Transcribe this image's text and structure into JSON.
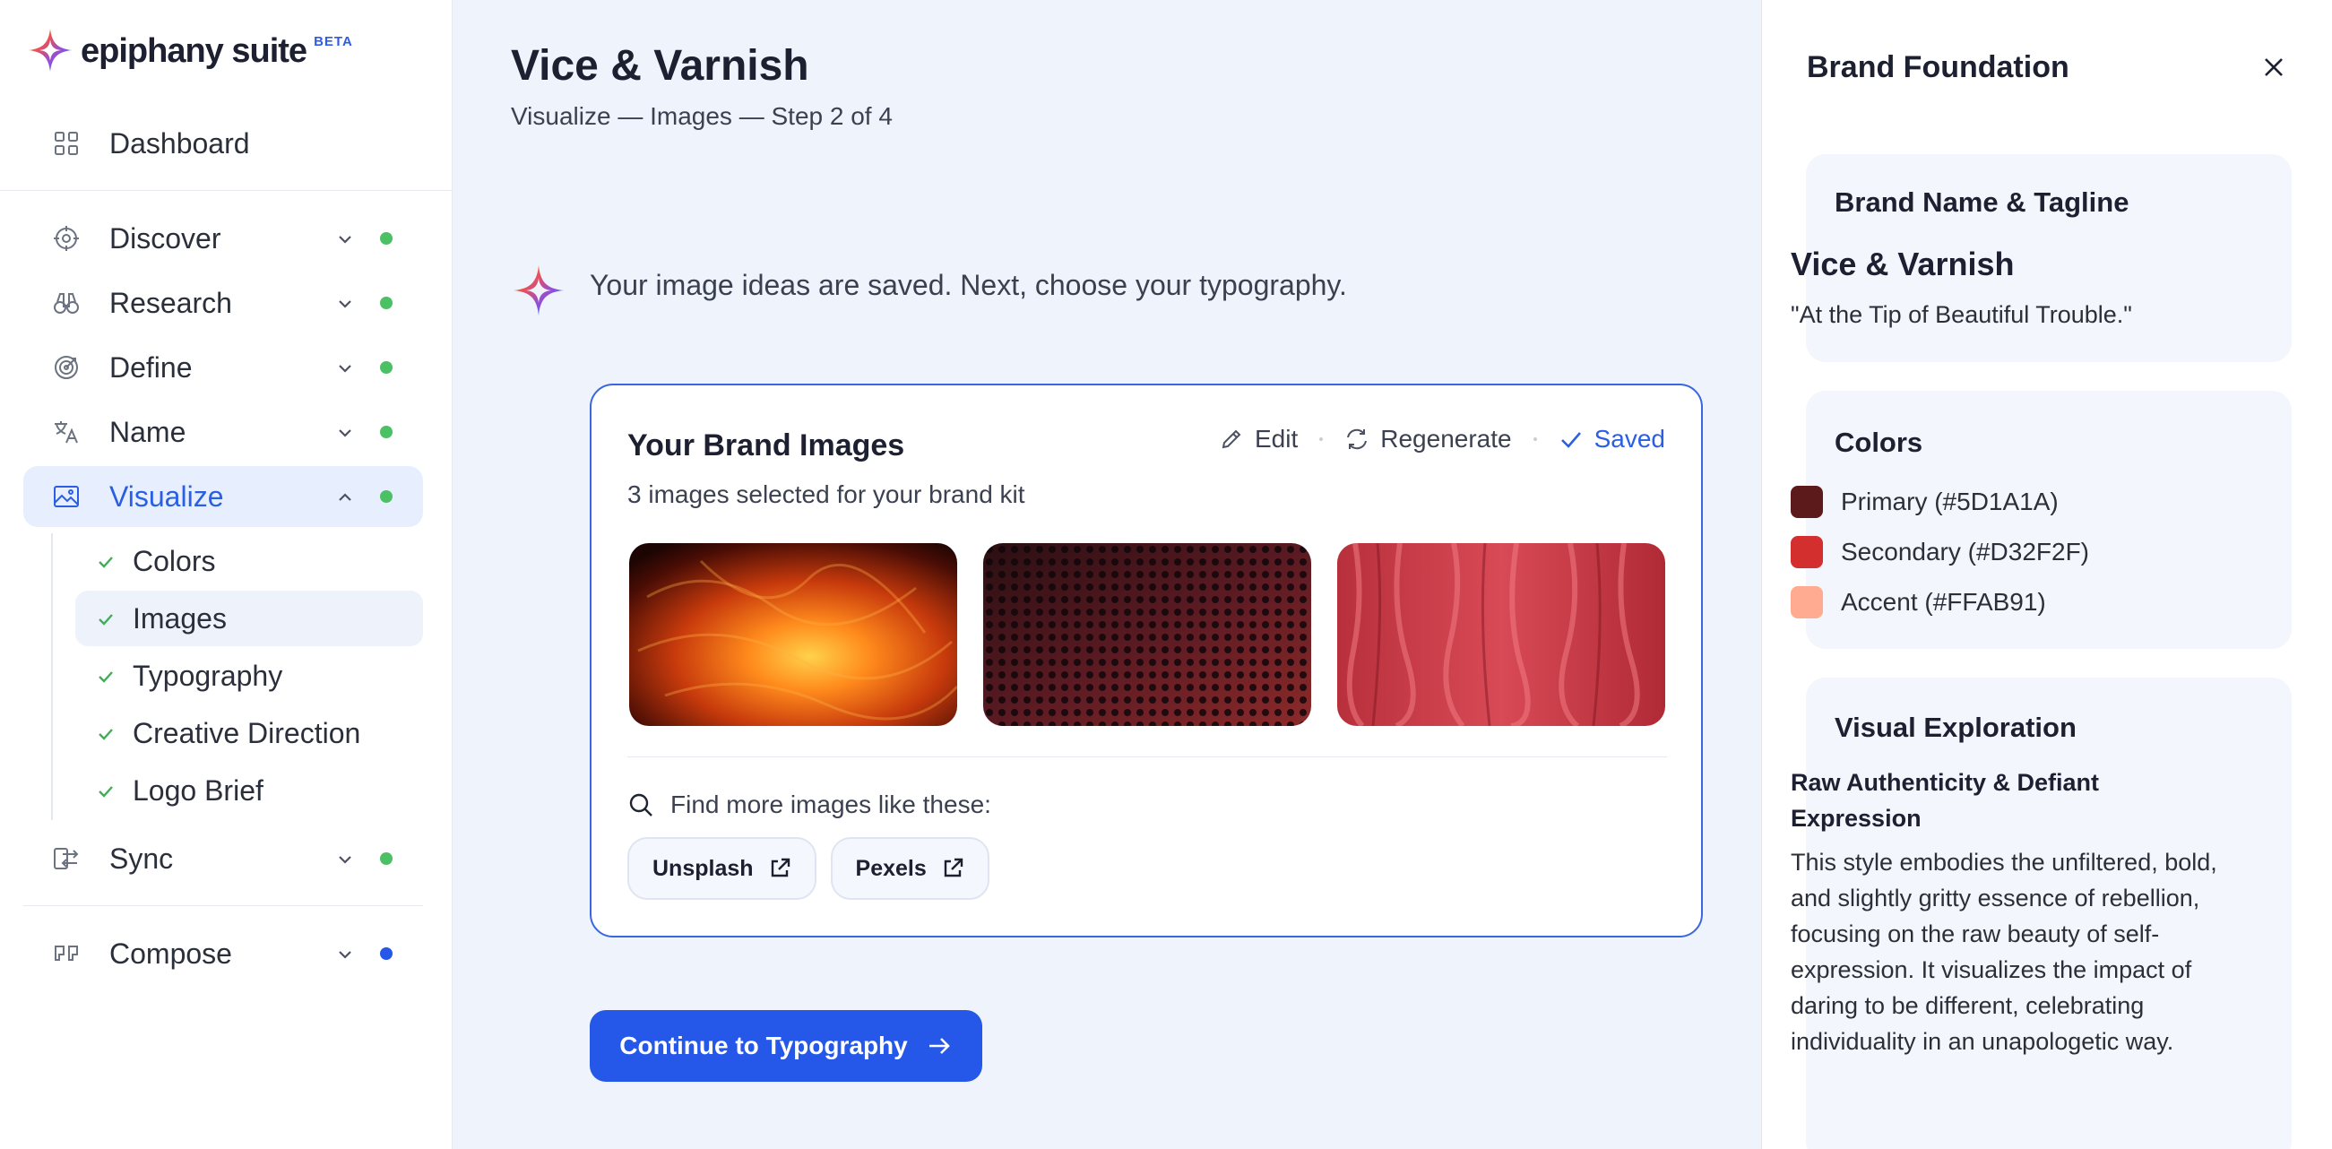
{
  "app": {
    "name": "epiphany suite",
    "badge": "BETA"
  },
  "sidebar": {
    "dashboard": "Dashboard",
    "items": [
      {
        "label": "Discover",
        "status": "complete"
      },
      {
        "label": "Research",
        "status": "complete"
      },
      {
        "label": "Define",
        "status": "complete"
      },
      {
        "label": "Name",
        "status": "complete"
      },
      {
        "label": "Visualize",
        "status": "complete",
        "expanded": true
      },
      {
        "label": "Sync",
        "status": "complete"
      },
      {
        "label": "Compose",
        "status": "in-progress"
      }
    ],
    "visualize_sub": [
      {
        "label": "Colors",
        "done": true
      },
      {
        "label": "Images",
        "done": true,
        "current": true
      },
      {
        "label": "Typography",
        "done": true
      },
      {
        "label": "Creative Direction",
        "done": true
      },
      {
        "label": "Logo Brief",
        "done": true
      }
    ]
  },
  "main": {
    "title": "Vice & Varnish",
    "subtitle": "Visualize — Images — Step 2 of 4",
    "assistant_message": "Your image ideas are saved. Next, choose your typography.",
    "card": {
      "title": "Your Brand Images",
      "subtitle": "3 images selected for your brand kit",
      "actions": {
        "edit": "Edit",
        "regenerate": "Regenerate",
        "saved": "Saved"
      },
      "images": [
        "warm-orange-abstract",
        "dark-red-perforated-metal",
        "red-textured-surface"
      ],
      "find_more": "Find more images like these:",
      "sources": [
        "Unsplash",
        "Pexels"
      ]
    },
    "continue_button": "Continue to Typography"
  },
  "panel": {
    "title": "Brand Foundation",
    "brand": {
      "heading": "Brand Name & Tagline",
      "name": "Vice & Varnish",
      "tagline": "\"At the Tip of Beautiful Trouble.\""
    },
    "colors": {
      "heading": "Colors",
      "items": [
        {
          "label": "Primary (#5D1A1A)",
          "hex": "#5D1A1A"
        },
        {
          "label": "Secondary (#D32F2F)",
          "hex": "#D32F2F"
        },
        {
          "label": "Accent (#FFAB91)",
          "hex": "#FFAB91"
        }
      ]
    },
    "visual": {
      "heading": "Visual Exploration",
      "style_title": "Raw Authenticity & Defiant Expression",
      "description": "This style embodies the unfiltered, bold, and slightly gritty essence of rebellion, focusing on the raw beauty of self-expression. It visualizes the impact of daring to be different, celebrating individuality in an unapologetic way."
    }
  },
  "colors": {
    "accent": "#2557E8",
    "status_complete": "#4CC064",
    "status_in_progress": "#2557E8"
  }
}
